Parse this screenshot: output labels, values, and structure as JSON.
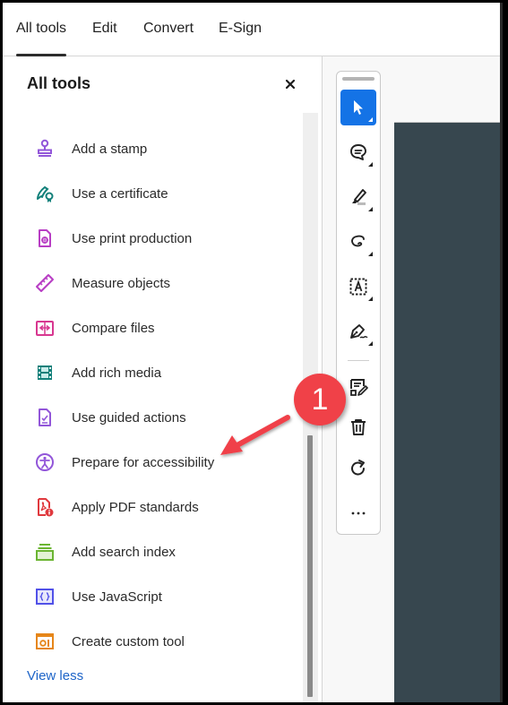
{
  "top_tabs": [
    {
      "label": "All tools",
      "active": true
    },
    {
      "label": "Edit",
      "active": false
    },
    {
      "label": "Convert",
      "active": false
    },
    {
      "label": "E-Sign",
      "active": false
    }
  ],
  "panel": {
    "title": "All tools",
    "close_icon": "close-icon",
    "items": [
      {
        "label": "Add a stamp",
        "icon": "stamp-icon",
        "color": "#9256d9"
      },
      {
        "label": "Use a certificate",
        "icon": "certificate-icon",
        "color": "#12807a"
      },
      {
        "label": "Use print production",
        "icon": "print-production-icon",
        "color": "#b83ec4"
      },
      {
        "label": "Measure objects",
        "icon": "ruler-icon",
        "color": "#b83ec4"
      },
      {
        "label": "Compare files",
        "icon": "compare-files-icon",
        "color": "#d83790"
      },
      {
        "label": "Add rich media",
        "icon": "film-strip-icon",
        "color": "#12807a"
      },
      {
        "label": "Use guided actions",
        "icon": "guided-actions-icon",
        "color": "#9256d9"
      },
      {
        "label": "Prepare for accessibility",
        "icon": "accessibility-icon",
        "color": "#9256d9"
      },
      {
        "label": "Apply PDF standards",
        "icon": "pdf-standards-icon",
        "color": "#e0393e"
      },
      {
        "label": "Add search index",
        "icon": "search-index-icon",
        "color": "#6bb532"
      },
      {
        "label": "Use JavaScript",
        "icon": "javascript-icon",
        "color": "#5151e8"
      },
      {
        "label": "Create custom tool",
        "icon": "custom-tool-icon",
        "color": "#e68619"
      }
    ],
    "view_less": "View less",
    "scroll_position": 0.55
  },
  "toolbar": {
    "tools": [
      {
        "name": "select-tool",
        "icon": "pointer-icon",
        "selected": true
      },
      {
        "name": "comment-tool",
        "icon": "comment-icon",
        "selected": false
      },
      {
        "name": "highlight-tool",
        "icon": "highlighter-icon",
        "selected": false
      },
      {
        "name": "draw-tool",
        "icon": "freehand-draw-icon",
        "selected": false
      },
      {
        "name": "text-recognition-tool",
        "icon": "text-box-icon",
        "selected": false
      },
      {
        "name": "sign-tool",
        "icon": "pen-sign-icon",
        "selected": false
      },
      {
        "name": "edit-form-tool",
        "icon": "form-edit-icon",
        "selected": false
      },
      {
        "name": "delete-tool",
        "icon": "trash-icon",
        "selected": false
      },
      {
        "name": "rotate-tool",
        "icon": "rotate-icon",
        "selected": false
      },
      {
        "name": "more-tools",
        "icon": "more-icon",
        "selected": false
      }
    ]
  },
  "annotation": {
    "callout_number": "1",
    "callout_color": "#f04148"
  },
  "colors": {
    "accent": "#1473e6",
    "link": "#1d64c8",
    "document_bg": "#37474f"
  }
}
